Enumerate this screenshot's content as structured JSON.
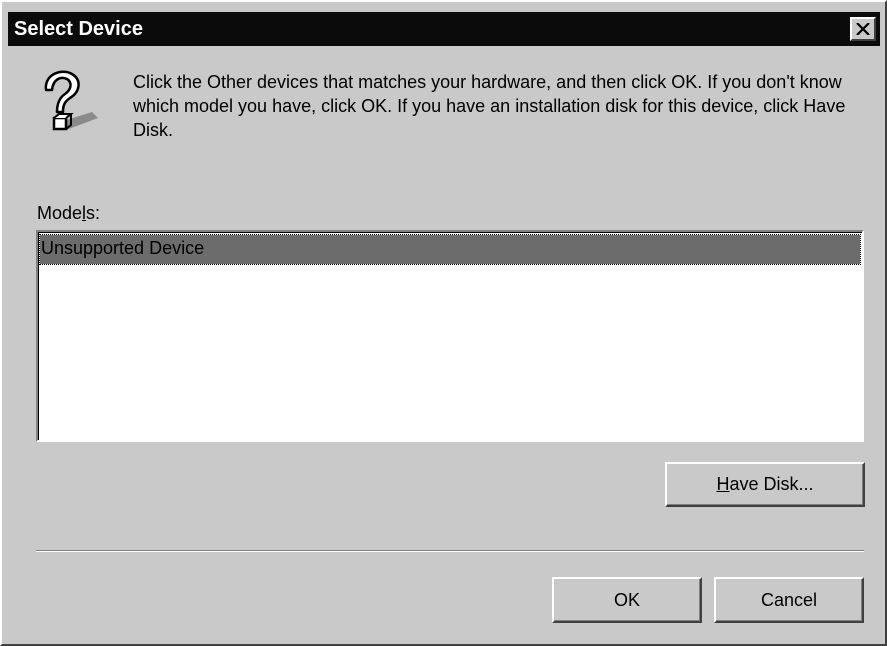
{
  "dialog": {
    "title": "Select Device",
    "close_label": "×",
    "message": "Click the Other devices that matches your hardware, and then click OK. If you don't know which model you have, click OK. If you have an installation disk for this device, click Have Disk.",
    "icon": "question-help-icon"
  },
  "models": {
    "label_before": "Mode",
    "label_accel": "l",
    "label_after": "s:",
    "items": [
      "Unsupported Device"
    ],
    "selected_index": 0
  },
  "buttons": {
    "have_disk_accel": "H",
    "have_disk_rest": "ave Disk...",
    "ok": "OK",
    "cancel": "Cancel"
  }
}
